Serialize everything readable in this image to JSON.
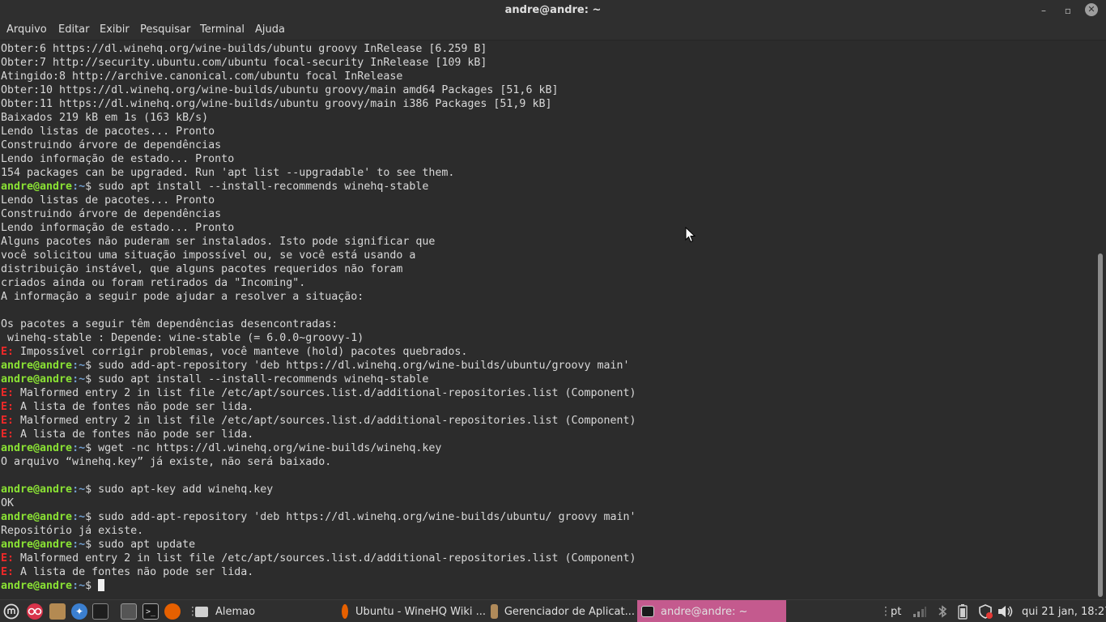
{
  "window": {
    "title": "andre@andre: ~",
    "minimize_glyph": "–",
    "maximize_glyph": "▫",
    "close_glyph": "✕"
  },
  "menu": {
    "items": [
      "Arquivo",
      "Editar",
      "Exibir",
      "Pesquisar",
      "Terminal",
      "Ajuda"
    ]
  },
  "prompt": {
    "user": "andre@andre",
    "path": ":~",
    "symbol": "$"
  },
  "terminal_lines": [
    {
      "type": "out",
      "text": "Obter:6 https://dl.winehq.org/wine-builds/ubuntu groovy InRelease [6.259 B]"
    },
    {
      "type": "out",
      "text": "Obter:7 http://security.ubuntu.com/ubuntu focal-security InRelease [109 kB]"
    },
    {
      "type": "out",
      "text": "Atingido:8 http://archive.canonical.com/ubuntu focal InRelease"
    },
    {
      "type": "out",
      "text": "Obter:10 https://dl.winehq.org/wine-builds/ubuntu groovy/main amd64 Packages [51,6 kB]"
    },
    {
      "type": "out",
      "text": "Obter:11 https://dl.winehq.org/wine-builds/ubuntu groovy/main i386 Packages [51,9 kB]"
    },
    {
      "type": "out",
      "text": "Baixados 219 kB em 1s (163 kB/s)"
    },
    {
      "type": "out",
      "text": "Lendo listas de pacotes... Pronto"
    },
    {
      "type": "out",
      "text": "Construindo árvore de dependências"
    },
    {
      "type": "out",
      "text": "Lendo informação de estado... Pronto"
    },
    {
      "type": "out",
      "text": "154 packages can be upgraded. Run 'apt list --upgradable' to see them."
    },
    {
      "type": "cmd",
      "text": " sudo apt install --install-recommends winehq-stable"
    },
    {
      "type": "out",
      "text": "Lendo listas de pacotes... Pronto"
    },
    {
      "type": "out",
      "text": "Construindo árvore de dependências"
    },
    {
      "type": "out",
      "text": "Lendo informação de estado... Pronto"
    },
    {
      "type": "out",
      "text": "Alguns pacotes não puderam ser instalados. Isto pode significar que"
    },
    {
      "type": "out",
      "text": "você solicitou uma situação impossível ou, se você está usando a"
    },
    {
      "type": "out",
      "text": "distribuição instável, que alguns pacotes requeridos não foram"
    },
    {
      "type": "out",
      "text": "criados ainda ou foram retirados da \"Incoming\"."
    },
    {
      "type": "out",
      "text": "A informação a seguir pode ajudar a resolver a situação:"
    },
    {
      "type": "out",
      "text": ""
    },
    {
      "type": "out",
      "text": "Os pacotes a seguir têm dependências desencontradas:"
    },
    {
      "type": "out",
      "text": " winehq-stable : Depende: wine-stable (= 6.0.0~groovy-1)"
    },
    {
      "type": "err",
      "text": " Impossível corrigir problemas, você manteve (hold) pacotes quebrados."
    },
    {
      "type": "cmd",
      "text": " sudo add-apt-repository 'deb https://dl.winehq.org/wine-builds/ubuntu/groovy main'"
    },
    {
      "type": "cmd",
      "text": " sudo apt install --install-recommends winehq-stable"
    },
    {
      "type": "err",
      "text": " Malformed entry 2 in list file /etc/apt/sources.list.d/additional-repositories.list (Component)"
    },
    {
      "type": "err",
      "text": " A lista de fontes não pode ser lida."
    },
    {
      "type": "err",
      "text": " Malformed entry 2 in list file /etc/apt/sources.list.d/additional-repositories.list (Component)"
    },
    {
      "type": "err",
      "text": " A lista de fontes não pode ser lida."
    },
    {
      "type": "cmd",
      "text": " wget -nc https://dl.winehq.org/wine-builds/winehq.key"
    },
    {
      "type": "out",
      "text": "O arquivo “winehq.key” já existe, não será baixado."
    },
    {
      "type": "out",
      "text": ""
    },
    {
      "type": "cmd",
      "text": " sudo apt-key add winehq.key"
    },
    {
      "type": "out",
      "text": "OK"
    },
    {
      "type": "cmd",
      "text": " sudo add-apt-repository 'deb https://dl.winehq.org/wine-builds/ubuntu/ groovy main'"
    },
    {
      "type": "out",
      "text": "Repositório já existe."
    },
    {
      "type": "cmd",
      "text": " sudo apt update"
    },
    {
      "type": "err",
      "text": " Malformed entry 2 in list file /etc/apt/sources.list.d/additional-repositories.list (Component)"
    },
    {
      "type": "err",
      "text": " A lista de fontes não pode ser lida."
    },
    {
      "type": "cmd",
      "text": " "
    }
  ],
  "error_prefix": "E:",
  "taskbar": {
    "menu_icon": "mint-menu-icon",
    "workspace_label": "Alemao",
    "tasks": [
      {
        "label": "Ubuntu - WineHQ Wiki ...",
        "icon": "firefox-icon"
      },
      {
        "label": "Gerenciador de Aplicat...",
        "icon": "software-manager-icon"
      },
      {
        "label": "andre@andre: ~",
        "icon": "terminal-icon"
      }
    ],
    "keyboard_layout": "pt",
    "clock": "qui 21 jan, 18:27"
  },
  "colors": {
    "prompt_user": "#8ae234",
    "prompt_path": "#729fcf",
    "error": "#ef2929",
    "active_task": "#c45a8e"
  }
}
